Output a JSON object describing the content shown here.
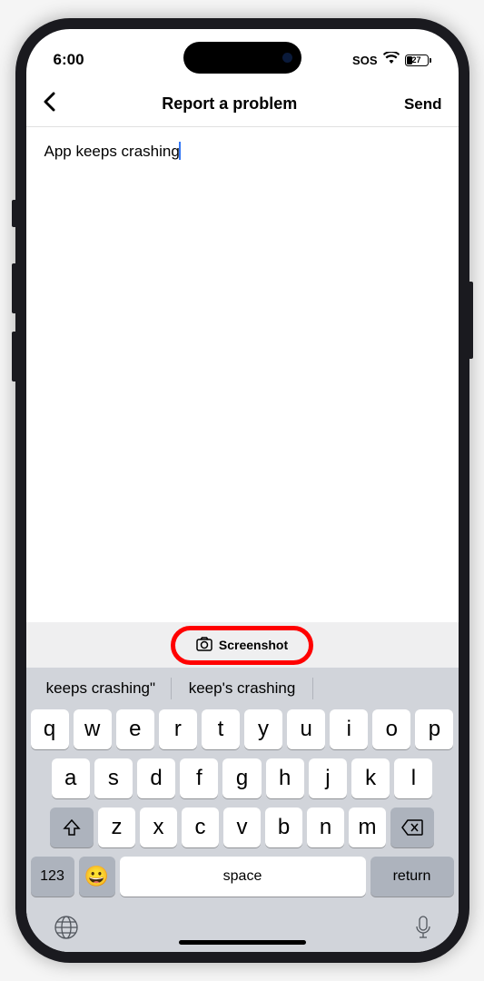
{
  "status_bar": {
    "time": "6:00",
    "sos_label": "SOS",
    "battery_percent": "27"
  },
  "nav": {
    "title": "Report a problem",
    "send_label": "Send"
  },
  "content": {
    "input_text": "App keeps crashing"
  },
  "screenshot_button": {
    "label": "Screenshot"
  },
  "keyboard": {
    "suggestions": [
      "keeps crashing\"",
      "keep's crashing"
    ],
    "row1": [
      "q",
      "w",
      "e",
      "r",
      "t",
      "y",
      "u",
      "i",
      "o",
      "p"
    ],
    "row2": [
      "a",
      "s",
      "d",
      "f",
      "g",
      "h",
      "j",
      "k",
      "l"
    ],
    "row3": [
      "z",
      "x",
      "c",
      "v",
      "b",
      "n",
      "m"
    ],
    "key_123": "123",
    "key_space": "space",
    "key_return": "return"
  }
}
